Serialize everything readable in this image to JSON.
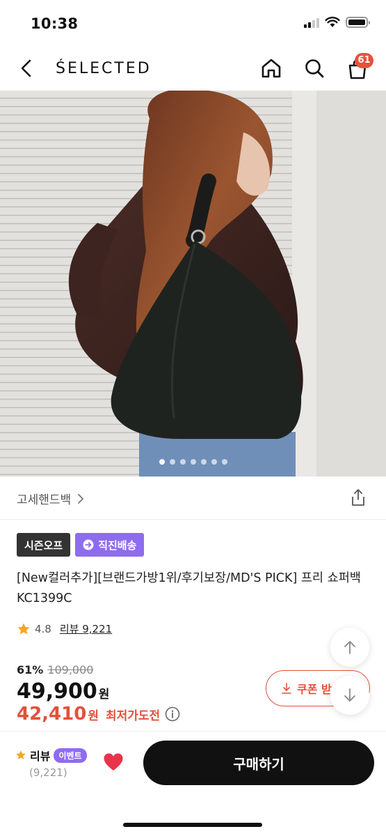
{
  "status_bar": {
    "time": "10:38"
  },
  "header": {
    "brand": "ŚELECTED",
    "cart_count": "61",
    "icons": [
      "back-icon",
      "home-icon",
      "search-icon",
      "shopping-bag-icon"
    ]
  },
  "hero": {
    "slide_count": 7,
    "active_slide": 1
  },
  "category": {
    "label": "고세핸드백"
  },
  "badges": {
    "season_off": "시즌오프",
    "direct_shipping": "직진배송"
  },
  "product": {
    "title": "[New컬러추가][브랜드가방1위/후기보장/MD'S PICK] 프리 쇼퍼백 KC1399C",
    "rating": "4.8",
    "review_link": "리뷰 9,221"
  },
  "price": {
    "discount_rate": "61%",
    "original_price": "109,000",
    "sale_price": "49,900",
    "currency": "원",
    "coupon_price": "42,410",
    "coupon_currency": "원",
    "lowest_label": "최저가도전"
  },
  "coupon_button": {
    "label": "쿠폰 받"
  },
  "bottom_bar": {
    "review_label": "리뷰",
    "event_label": "이벤트",
    "review_count": "(9,221)",
    "buy_label": "구매하기"
  },
  "colors": {
    "accent_red": "#e4503b",
    "badge_purple": "#8e6cf0",
    "badge_dark": "#333333",
    "buy_button": "#111111",
    "heart": "#e8334a",
    "star": "#f5a623"
  }
}
